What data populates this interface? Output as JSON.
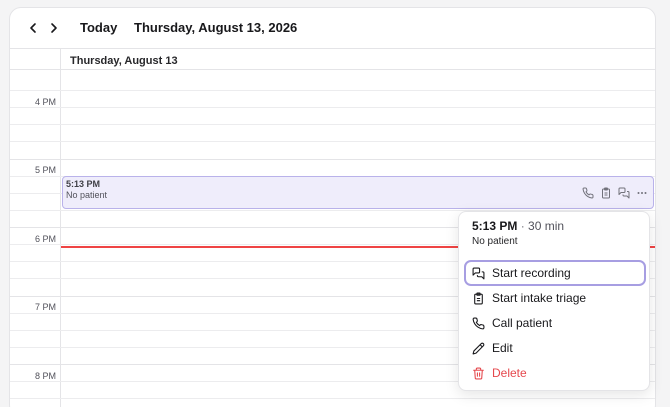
{
  "toolbar": {
    "today_label": "Today",
    "date_title": "Thursday, August 13, 2026"
  },
  "day_view": {
    "day_header": "Thursday, August 13",
    "hours": [
      "4 PM",
      "5 PM",
      "6 PM",
      "7 PM",
      "8 PM"
    ]
  },
  "event": {
    "time": "5:13 PM",
    "subtitle": "No patient",
    "actions": [
      "phone-icon",
      "clipboard-icon",
      "chat-icon",
      "more-icon"
    ]
  },
  "popover": {
    "time": "5:13 PM",
    "separator": "·",
    "duration": "30 min",
    "subtitle": "No patient",
    "menu": [
      {
        "label": "Start recording",
        "icon": "chat-icon",
        "highlighted": true
      },
      {
        "label": "Start intake triage",
        "icon": "clipboard-icon"
      },
      {
        "label": "Call patient",
        "icon": "phone-icon"
      },
      {
        "label": "Edit",
        "icon": "pencil-icon"
      },
      {
        "label": "Delete",
        "icon": "trash-icon",
        "color": "#e5484d"
      }
    ]
  },
  "colors": {
    "event_bg": "#efedfb",
    "event_border": "#b9b2ea",
    "now_line": "#ef4444",
    "focus_ring": "#a79ee2",
    "danger": "#e5484d"
  }
}
